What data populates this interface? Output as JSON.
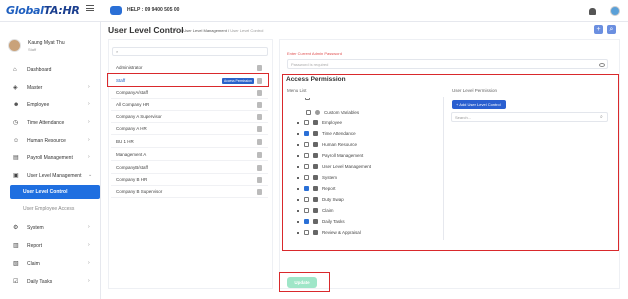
{
  "header": {
    "logo_text": "Global",
    "logo_suffix": "TA:HR",
    "help_text": "HELP : 09 9400 505 00"
  },
  "user": {
    "name": "Kaung Myat Thu",
    "role": "Staff"
  },
  "sidebar": {
    "items": [
      {
        "label": "Dashboard",
        "icon": "home-icon"
      },
      {
        "label": "Master",
        "icon": "shield-icon"
      },
      {
        "label": "Employee",
        "icon": "users-icon"
      },
      {
        "label": "Time Attendance",
        "icon": "clock-icon"
      },
      {
        "label": "Human Resource",
        "icon": "people-icon"
      },
      {
        "label": "Payroll Management",
        "icon": "payroll-icon"
      },
      {
        "label": "User Level Management",
        "icon": "user-level-icon"
      },
      {
        "label": "User Level Control",
        "icon": ""
      },
      {
        "label": "User Employee Access",
        "icon": ""
      },
      {
        "label": "System",
        "icon": "system-icon"
      },
      {
        "label": "Report",
        "icon": "report-icon"
      },
      {
        "label": "Claim",
        "icon": "claim-icon"
      },
      {
        "label": "Daily Tasks",
        "icon": "tasks-icon"
      }
    ]
  },
  "page": {
    "title": "User Level Control",
    "breadcrumb_parent": "User Level Management",
    "breadcrumb_separator": "/",
    "breadcrumb_current": "User Level Control"
  },
  "levels": {
    "search_placeholder": "",
    "items": [
      {
        "name": "Administrator"
      },
      {
        "name": "Staff",
        "badge": "Access Permission"
      },
      {
        "name": "CompanyA/staff"
      },
      {
        "name": "All Company HR"
      },
      {
        "name": "Company A Supervisor"
      },
      {
        "name": "Company A HR"
      },
      {
        "name": "BU 1 HR"
      },
      {
        "name": "Management A"
      },
      {
        "name": "CompanyB/staff"
      },
      {
        "name": "Company B HR"
      },
      {
        "name": "Company B Supervisor"
      }
    ]
  },
  "password": {
    "label": "Enter Current Admin Password",
    "placeholder": "Password is required"
  },
  "permission": {
    "title": "Access Permission",
    "menu_list_label": "Menu List",
    "user_level_label": "User Level Permission",
    "add_button": "Add User Level Control",
    "search_placeholder": "Search...",
    "menu": [
      {
        "label": "Custom Variables",
        "checked": false
      },
      {
        "label": "Employee",
        "checked": false
      },
      {
        "label": "Time Attendance",
        "checked": true
      },
      {
        "label": "Human Resource",
        "checked": false
      },
      {
        "label": "Payroll Management",
        "checked": false
      },
      {
        "label": "User Level Management",
        "checked": false
      },
      {
        "label": "System",
        "checked": false
      },
      {
        "label": "Report",
        "checked": true
      },
      {
        "label": "Duty Swap",
        "checked": false
      },
      {
        "label": "Claim",
        "checked": false
      },
      {
        "label": "Daily Tasks",
        "checked": true
      },
      {
        "label": "Review & Appraisal",
        "checked": false
      }
    ]
  },
  "actions": {
    "update": "Update"
  },
  "colors": {
    "accent": "#1f6fe0",
    "highlight_box": "#d9292c",
    "update_button": "#9fe6c8"
  }
}
